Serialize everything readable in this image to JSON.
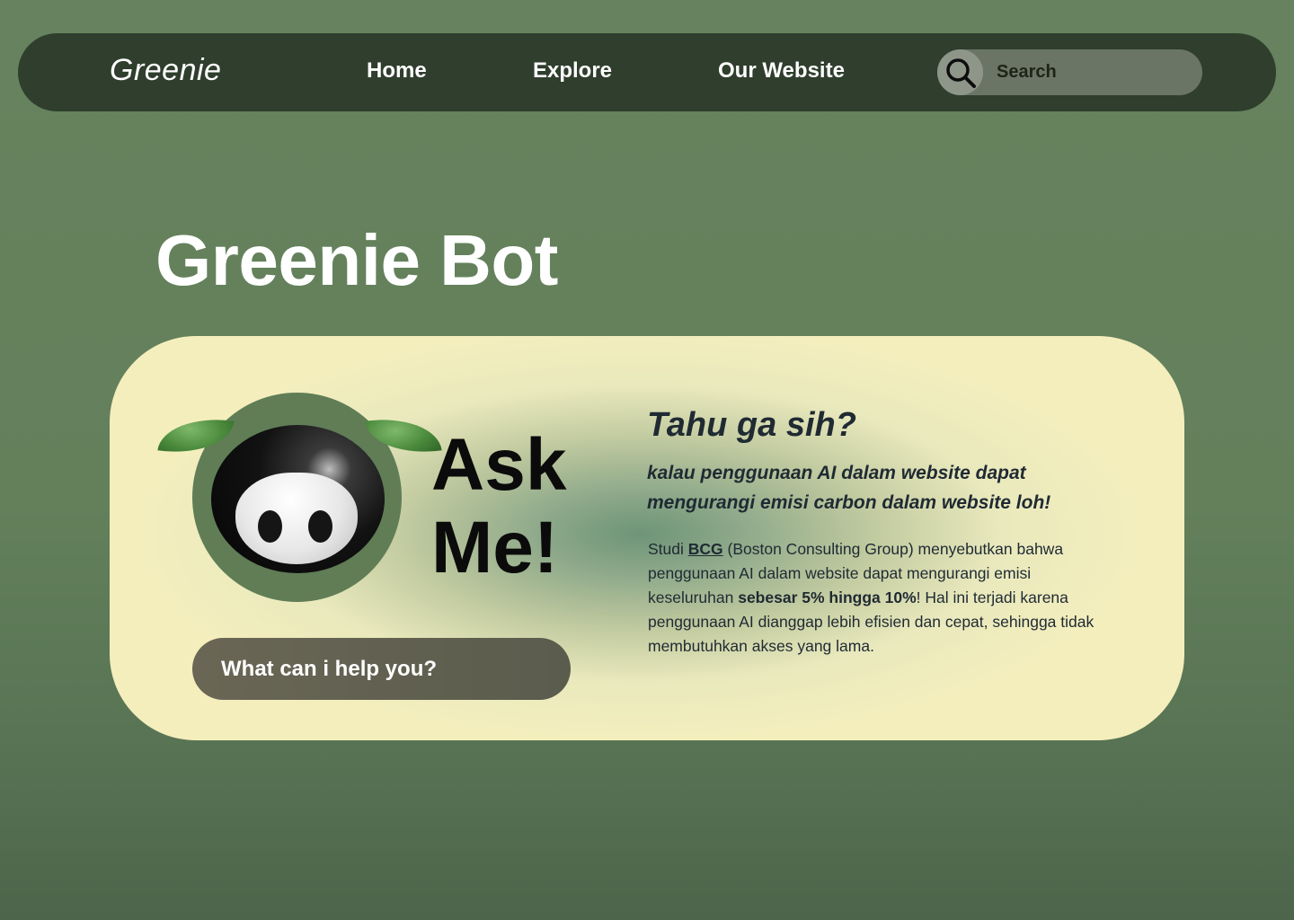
{
  "navbar": {
    "brand": "Greenie",
    "links": [
      {
        "label": "Home"
      },
      {
        "label": "Explore"
      },
      {
        "label": "Our Website"
      }
    ],
    "search": {
      "placeholder": "Search",
      "icon": "search-icon"
    }
  },
  "page": {
    "title": "Greenie Bot"
  },
  "bot_card": {
    "ask_line1": "Ask",
    "ask_line2": "Me!",
    "help_button_label": "What can i help you?",
    "mascot_icon": "greenie-mascot-icon"
  },
  "fact": {
    "heading": "Tahu ga sih?",
    "subheading": "kalau penggunaan AI dalam website dapat mengurangi emisi carbon dalam website loh!",
    "body_part1": "Studi ",
    "body_link": "BCG",
    "body_part2": " (Boston Consulting Group) menyebutkan bahwa penggunaan AI dalam website dapat mengurangi emisi keseluruhan ",
    "body_bold": "sebesar 5% hingga 10%",
    "body_part3": "! Hal ini terjadi karena penggunaan AI dianggap lebih efisien dan cepat, sehingga tidak membutuhkan akses yang lama."
  },
  "colors": {
    "background": "#63805b",
    "navbar": "#2f3e2d",
    "card": "#f4eebd",
    "mascot_ring": "#607d56",
    "button": "#625f50",
    "text_dark": "#1f2a33"
  }
}
